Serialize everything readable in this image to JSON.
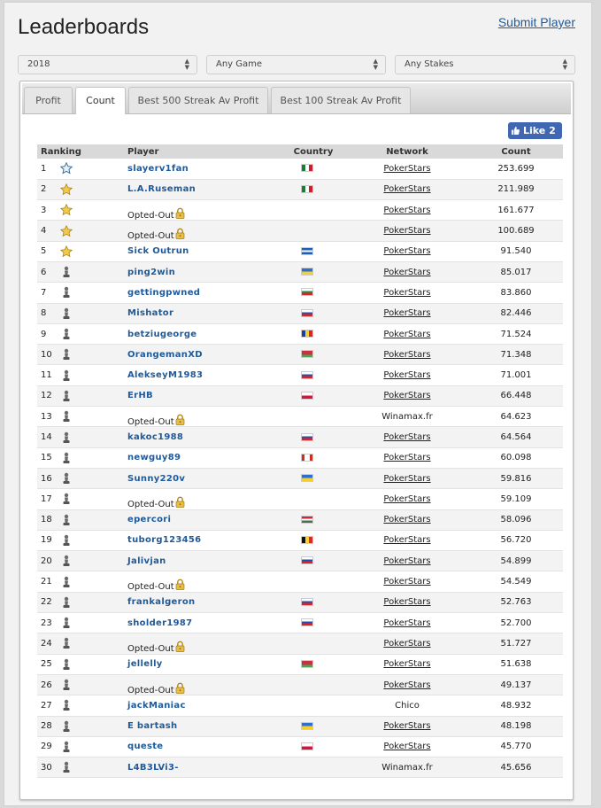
{
  "header": {
    "title": "Leaderboards",
    "submit_label": "Submit Player"
  },
  "filters": [
    {
      "name": "year-select",
      "value": "2018"
    },
    {
      "name": "game-select",
      "value": "Any Game"
    },
    {
      "name": "stakes-select",
      "value": "Any Stakes"
    }
  ],
  "tabs": [
    "Profit",
    "Count",
    "Best 500 Streak Av Profit",
    "Best 100 Streak Av Profit"
  ],
  "active_tab": "Count",
  "like_label": "Like 2",
  "table": {
    "headers": {
      "ranking": "Ranking",
      "player": "Player",
      "country": "Country",
      "network": "Network",
      "count": "Count"
    },
    "rows": [
      {
        "rank": "1",
        "icon": "star-blue-icon",
        "player": "slayerv1fan",
        "opted": false,
        "country": "mexico",
        "network": "PokerStars",
        "link": true,
        "count": "253.699"
      },
      {
        "rank": "2",
        "icon": "star-gold-icon",
        "player": "L.A.Ruseman",
        "opted": false,
        "country": "mexico",
        "network": "PokerStars",
        "link": true,
        "count": "211.989"
      },
      {
        "rank": "3",
        "icon": "star-gold-icon",
        "player": "Opted-Out",
        "opted": true,
        "country": "",
        "network": "PokerStars",
        "link": true,
        "count": "161.677"
      },
      {
        "rank": "4",
        "icon": "star-gold-icon",
        "player": "Opted-Out",
        "opted": true,
        "country": "",
        "network": "PokerStars",
        "link": true,
        "count": "100.689"
      },
      {
        "rank": "5",
        "icon": "star-gold-icon",
        "player": "Sick Outrun",
        "opted": false,
        "country": "honduras",
        "network": "PokerStars",
        "link": true,
        "count": "91.540"
      },
      {
        "rank": "6",
        "icon": "pawn-icon",
        "player": "ping2win",
        "opted": false,
        "country": "ukraine",
        "network": "PokerStars",
        "link": true,
        "count": "85.017"
      },
      {
        "rank": "7",
        "icon": "pawn-icon",
        "player": "gettingpwned",
        "opted": false,
        "country": "bulgaria",
        "network": "PokerStars",
        "link": true,
        "count": "83.860"
      },
      {
        "rank": "8",
        "icon": "pawn-icon",
        "player": "Mishator",
        "opted": false,
        "country": "russia",
        "network": "PokerStars",
        "link": true,
        "count": "82.446"
      },
      {
        "rank": "9",
        "icon": "pawn-icon",
        "player": "betziugeorge",
        "opted": false,
        "country": "romania",
        "network": "PokerStars",
        "link": true,
        "count": "71.524"
      },
      {
        "rank": "10",
        "icon": "pawn-icon",
        "player": "OrangemanXD",
        "opted": false,
        "country": "belarus",
        "network": "PokerStars",
        "link": true,
        "count": "71.348"
      },
      {
        "rank": "11",
        "icon": "pawn-icon",
        "player": "AlekseyM1983",
        "opted": false,
        "country": "russia",
        "network": "PokerStars",
        "link": true,
        "count": "71.001"
      },
      {
        "rank": "12",
        "icon": "pawn-icon",
        "player": "ErHB",
        "opted": false,
        "country": "poland",
        "network": "PokerStars",
        "link": true,
        "count": "66.448"
      },
      {
        "rank": "13",
        "icon": "pawn-icon",
        "player": "Opted-Out",
        "opted": true,
        "country": "",
        "network": "Winamax.fr",
        "link": false,
        "count": "64.623"
      },
      {
        "rank": "14",
        "icon": "pawn-icon",
        "player": "kakoc1988",
        "opted": false,
        "country": "russia",
        "network": "PokerStars",
        "link": true,
        "count": "64.564"
      },
      {
        "rank": "15",
        "icon": "pawn-icon",
        "player": "newguy89",
        "opted": false,
        "country": "canada",
        "network": "PokerStars",
        "link": true,
        "count": "60.098"
      },
      {
        "rank": "16",
        "icon": "pawn-icon",
        "player": "Sunny220v",
        "opted": false,
        "country": "ukraine",
        "network": "PokerStars",
        "link": true,
        "count": "59.816"
      },
      {
        "rank": "17",
        "icon": "pawn-icon",
        "player": "Opted-Out",
        "opted": true,
        "country": "",
        "network": "PokerStars",
        "link": true,
        "count": "59.109"
      },
      {
        "rank": "18",
        "icon": "pawn-icon",
        "player": "epercori",
        "opted": false,
        "country": "hungary",
        "network": "PokerStars",
        "link": true,
        "count": "58.096"
      },
      {
        "rank": "19",
        "icon": "pawn-icon",
        "player": "tuborg123456",
        "opted": false,
        "country": "belgium",
        "network": "PokerStars",
        "link": true,
        "count": "56.720"
      },
      {
        "rank": "20",
        "icon": "pawn-icon",
        "player": "Jalivjan",
        "opted": false,
        "country": "slovakia",
        "network": "PokerStars",
        "link": true,
        "count": "54.899"
      },
      {
        "rank": "21",
        "icon": "pawn-icon",
        "player": "Opted-Out",
        "opted": true,
        "country": "",
        "network": "PokerStars",
        "link": true,
        "count": "54.549"
      },
      {
        "rank": "22",
        "icon": "pawn-icon",
        "player": "frankalgeron",
        "opted": false,
        "country": "russia",
        "network": "PokerStars",
        "link": true,
        "count": "52.763"
      },
      {
        "rank": "23",
        "icon": "pawn-icon",
        "player": "sholder1987",
        "opted": false,
        "country": "russia",
        "network": "PokerStars",
        "link": true,
        "count": "52.700"
      },
      {
        "rank": "24",
        "icon": "pawn-icon",
        "player": "Opted-Out",
        "opted": true,
        "country": "",
        "network": "PokerStars",
        "link": true,
        "count": "51.727"
      },
      {
        "rank": "25",
        "icon": "pawn-icon",
        "player": "jellelly",
        "opted": false,
        "country": "belarus",
        "network": "PokerStars",
        "link": true,
        "count": "51.638"
      },
      {
        "rank": "26",
        "icon": "pawn-icon",
        "player": "Opted-Out",
        "opted": true,
        "country": "",
        "network": "PokerStars",
        "link": true,
        "count": "49.137"
      },
      {
        "rank": "27",
        "icon": "pawn-icon",
        "player": "jackManiac",
        "opted": false,
        "country": "",
        "network": "Chico",
        "link": false,
        "count": "48.932"
      },
      {
        "rank": "28",
        "icon": "pawn-icon",
        "player": "E bartash",
        "opted": false,
        "country": "ukraine",
        "network": "PokerStars",
        "link": true,
        "count": "48.198"
      },
      {
        "rank": "29",
        "icon": "pawn-icon",
        "player": "queste",
        "opted": false,
        "country": "poland",
        "network": "PokerStars",
        "link": true,
        "count": "45.770"
      },
      {
        "rank": "30",
        "icon": "pawn-icon",
        "player": "L4B3LVi3-",
        "opted": false,
        "country": "",
        "network": "Winamax.fr",
        "link": false,
        "count": "45.656"
      }
    ]
  }
}
